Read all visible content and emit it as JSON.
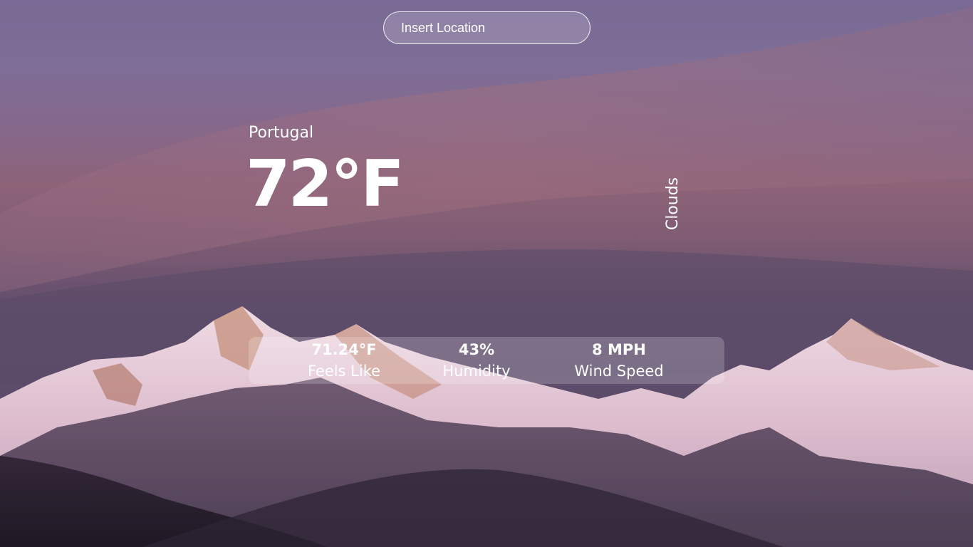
{
  "search": {
    "placeholder": "Insert Location"
  },
  "weather": {
    "location": "Portugal",
    "temperature": "72°F",
    "condition": "Clouds"
  },
  "stats": {
    "feels_like": {
      "value": "71.24°F",
      "label": "Feels Like"
    },
    "humidity": {
      "value": "43%",
      "label": "Humidity"
    },
    "wind_speed": {
      "value": "8 MPH",
      "label": "Wind Speed"
    }
  },
  "colors": {
    "sky_top": "#7c6d98",
    "sky_mid": "#8d6176",
    "sky_low": "#604e6c",
    "snow": "#ead3df",
    "rock": "#4c3c55",
    "foothill": "#2c2232",
    "text": "#ffffff"
  }
}
